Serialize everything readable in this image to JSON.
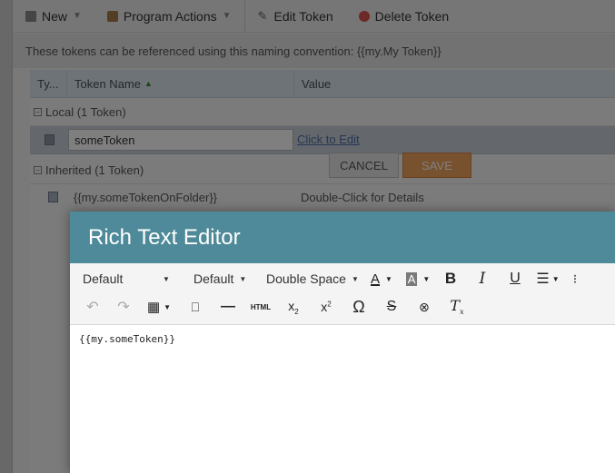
{
  "toolbar": {
    "new_label": "New",
    "program_actions_label": "Program Actions",
    "edit_token_label": "Edit Token",
    "delete_token_label": "Delete Token"
  },
  "banner": {
    "text": "These tokens can be referenced using this naming convention: {{my.My Token}}"
  },
  "grid": {
    "columns": {
      "type": "Ty...",
      "name": "Token Name",
      "value": "Value"
    },
    "local_group": "Local (1 Token)",
    "edit_row": {
      "name_value": "someToken",
      "link": "Click to Edit"
    },
    "buttons": {
      "cancel": "CANCEL",
      "save": "SAVE"
    },
    "inherited_group": "Inherited (1 Token)",
    "inherited_item": {
      "name": "{{my.someTokenOnFolder}}",
      "value": "Double-Click for Details"
    }
  },
  "editor": {
    "title": "Rich Text Editor",
    "font_family": "Default",
    "font_size": "Default",
    "line_spacing": "Double Space",
    "html_label": "HTML",
    "omega_label": "Ω",
    "content": "{{my.someToken}}"
  },
  "icons": {
    "undo": "undo-icon",
    "redo": "redo-icon",
    "table": "table-icon",
    "bookmark": "bookmark-icon",
    "hr": "horizontal-rule-icon",
    "subscript": "subscript-icon",
    "superscript": "superscript-icon",
    "special_char": "omega-icon",
    "strike": "strikethrough-icon",
    "find": "binoculars-icon",
    "clear_format": "clear-format-icon"
  },
  "colors": {
    "modal_header": "#4e8a99",
    "save_button": "#f0a35f",
    "link": "#4a6fa5"
  }
}
